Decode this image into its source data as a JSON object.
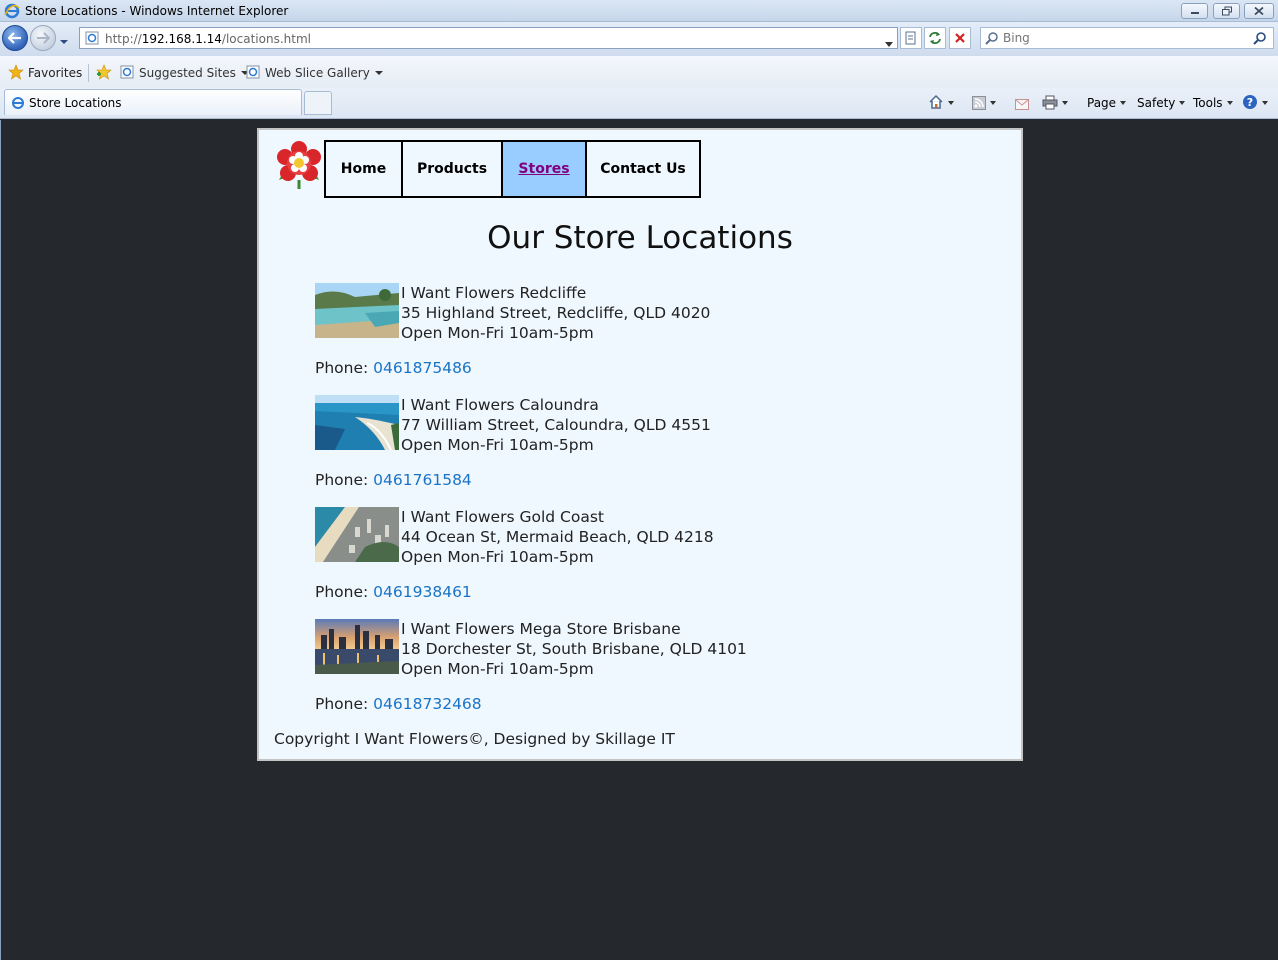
{
  "window": {
    "title": "Store Locations - Windows Internet Explorer"
  },
  "address": {
    "url_prefix": "http://",
    "url_host": "192.168.1.14",
    "url_path": "/locations.html"
  },
  "search": {
    "placeholder": "Bing"
  },
  "favorites_bar": {
    "favorites_label": "Favorites",
    "suggested_sites_label": "Suggested Sites",
    "web_slice_gallery_label": "Web Slice Gallery"
  },
  "tabs": [
    {
      "label": "Store Locations"
    }
  ],
  "command_bar": {
    "page_label": "Page",
    "safety_label": "Safety",
    "tools_label": "Tools"
  },
  "site": {
    "nav": [
      {
        "label": "Home"
      },
      {
        "label": "Products"
      },
      {
        "label": "Stores"
      },
      {
        "label": "Contact Us"
      }
    ],
    "heading": "Our Store Locations",
    "stores": [
      {
        "name": "I Want Flowers Redcliffe",
        "address": "35 Highland Street, Redcliffe, QLD 4020",
        "hours": "Open Mon-Fri 10am-5pm",
        "phone_label": "Phone: ",
        "phone": "0461875486"
      },
      {
        "name": "I Want Flowers Caloundra",
        "address": "77 William Street, Caloundra, QLD 4551",
        "hours": "Open Mon-Fri 10am-5pm",
        "phone_label": "Phone: ",
        "phone": "0461761584"
      },
      {
        "name": "I Want Flowers Gold Coast",
        "address": "44 Ocean St, Mermaid Beach, QLD 4218",
        "hours": "Open Mon-Fri 10am-5pm",
        "phone_label": "Phone: ",
        "phone": "0461938461"
      },
      {
        "name": "I Want Flowers Mega Store Brisbane",
        "address": "18 Dorchester St, South Brisbane, QLD 4101",
        "hours": "Open Mon-Fri 10am-5pm",
        "phone_label": "Phone: ",
        "phone": "04618732468"
      }
    ],
    "footer": "Copyright I Want Flowers©, Designed by Skillage IT"
  },
  "colors": {
    "page_background": "#f0f8ff",
    "outer_background": "#25282d",
    "active_nav_background": "#99ccff",
    "active_nav_text": "#800080",
    "link": "#1a73c6"
  }
}
